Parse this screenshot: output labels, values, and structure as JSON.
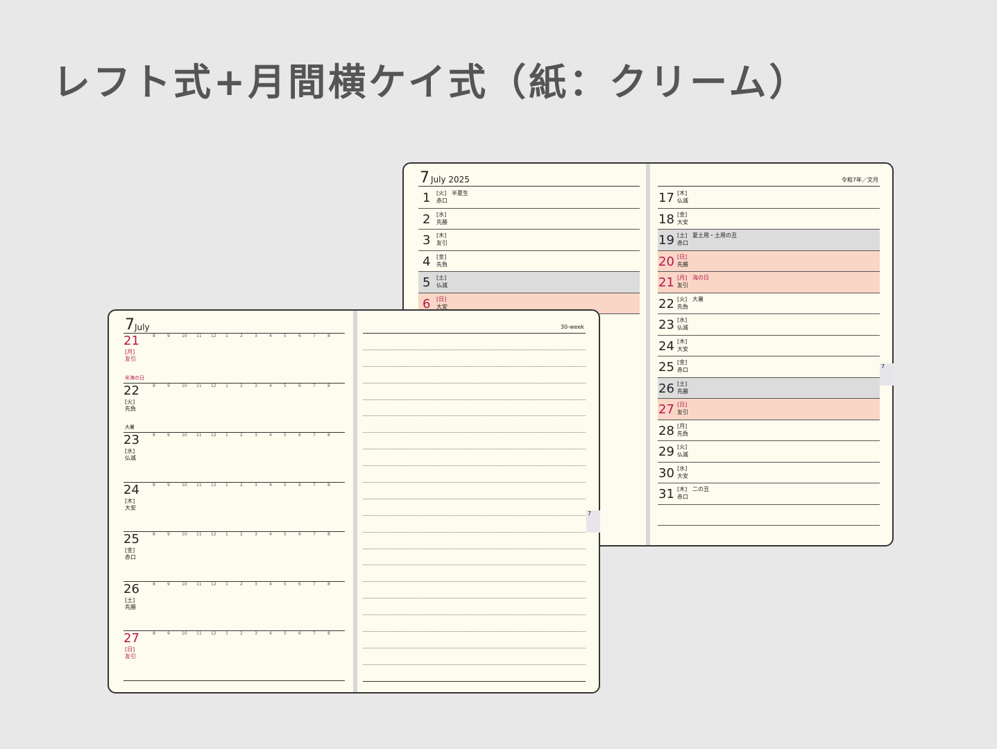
{
  "title": "レフト式+月間横ケイ式（紙：クリーム）",
  "monthly": {
    "month_num": "7",
    "month_name": "July 2025",
    "era": "令和7年／文月",
    "left_rows": [
      {
        "d": "1",
        "wd": "[火]",
        "rk": "赤口",
        "ev": "半夏生",
        "type": "normal"
      },
      {
        "d": "2",
        "wd": "[水]",
        "rk": "先勝",
        "ev": "",
        "type": "normal"
      },
      {
        "d": "3",
        "wd": "[木]",
        "rk": "友引",
        "ev": "",
        "type": "normal"
      },
      {
        "d": "4",
        "wd": "[金]",
        "rk": "先負",
        "ev": "",
        "type": "normal"
      },
      {
        "d": "5",
        "wd": "[土]",
        "rk": "仏滅",
        "ev": "",
        "type": "sat"
      },
      {
        "d": "6",
        "wd": "[日]",
        "rk": "大安",
        "ev": "",
        "type": "sun"
      }
    ],
    "right_rows": [
      {
        "d": "17",
        "wd": "[木]",
        "rk": "仏滅",
        "ev": "",
        "type": "normal"
      },
      {
        "d": "18",
        "wd": "[金]",
        "rk": "大安",
        "ev": "",
        "type": "normal"
      },
      {
        "d": "19",
        "wd": "[土]",
        "rk": "赤口",
        "ev": "夏土用・土用の丑",
        "type": "sat"
      },
      {
        "d": "20",
        "wd": "[日]",
        "rk": "先勝",
        "ev": "",
        "type": "sun"
      },
      {
        "d": "21",
        "wd": "[月]",
        "rk": "友引",
        "ev": "海の日",
        "type": "sun"
      },
      {
        "d": "22",
        "wd": "[火]",
        "rk": "先負",
        "ev": "大暑",
        "type": "normal"
      },
      {
        "d": "23",
        "wd": "[水]",
        "rk": "仏滅",
        "ev": "",
        "type": "normal"
      },
      {
        "d": "24",
        "wd": "[木]",
        "rk": "大安",
        "ev": "",
        "type": "normal"
      },
      {
        "d": "25",
        "wd": "[金]",
        "rk": "赤口",
        "ev": "",
        "type": "normal"
      },
      {
        "d": "26",
        "wd": "[土]",
        "rk": "先勝",
        "ev": "",
        "type": "sat"
      },
      {
        "d": "27",
        "wd": "[日]",
        "rk": "友引",
        "ev": "",
        "type": "sun"
      },
      {
        "d": "28",
        "wd": "[月]",
        "rk": "先負",
        "ev": "",
        "type": "normal"
      },
      {
        "d": "29",
        "wd": "[火]",
        "rk": "仏滅",
        "ev": "",
        "type": "normal"
      },
      {
        "d": "30",
        "wd": "[水]",
        "rk": "大安",
        "ev": "",
        "type": "normal"
      },
      {
        "d": "31",
        "wd": "[木]",
        "rk": "赤口",
        "ev": "二の丑",
        "type": "normal"
      }
    ],
    "tab": "7"
  },
  "weekly": {
    "month_num": "7",
    "month_name": "July",
    "week_label": "30-week",
    "hours": [
      "8",
      "9",
      "10",
      "11",
      "12",
      "1",
      "2",
      "3",
      "4",
      "5",
      "6",
      "7",
      "8"
    ],
    "rows": [
      {
        "d": "21",
        "wd": "[月]",
        "rk": "友引",
        "note": "㊗海の日",
        "type": "sun"
      },
      {
        "d": "22",
        "wd": "[火]",
        "rk": "先負",
        "note": "大暑",
        "type": "normal"
      },
      {
        "d": "23",
        "wd": "[水]",
        "rk": "仏滅",
        "note": "",
        "type": "normal"
      },
      {
        "d": "24",
        "wd": "[木]",
        "rk": "大安",
        "note": "",
        "type": "normal"
      },
      {
        "d": "25",
        "wd": "[金]",
        "rk": "赤口",
        "note": "",
        "type": "normal"
      },
      {
        "d": "26",
        "wd": "[土]",
        "rk": "先勝",
        "note": "",
        "type": "normal"
      },
      {
        "d": "27",
        "wd": "[日]",
        "rk": "友引",
        "note": "",
        "type": "sun"
      }
    ],
    "tab": "7"
  }
}
